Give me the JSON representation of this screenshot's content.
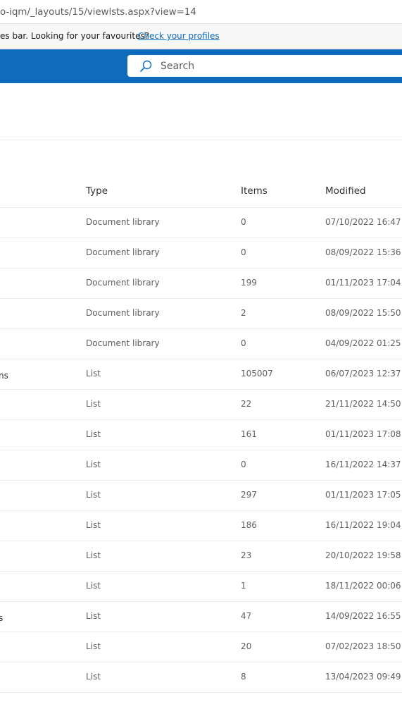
{
  "browser": {
    "address": "o-iqm/_layouts/15/viewlsts.aspx?view=14"
  },
  "info_bar": {
    "message": "es bar. Looking for your favourites?",
    "link_label": "Check your profiles"
  },
  "suite_bar": {
    "search_placeholder": "Search",
    "accent_color": "#0f6cbd"
  },
  "table": {
    "columns": [
      "Type",
      "Items",
      "Modified"
    ],
    "rows": [
      {
        "name": "",
        "type": "Document library",
        "items": "0",
        "modified": "07/10/2022 16:47"
      },
      {
        "name": "",
        "type": "Document library",
        "items": "0",
        "modified": "08/09/2022 15:36"
      },
      {
        "name": "",
        "type": "Document library",
        "items": "199",
        "modified": "01/11/2023 17:04"
      },
      {
        "name": "",
        "type": "Document library",
        "items": "2",
        "modified": "08/09/2022 15:50"
      },
      {
        "name": "",
        "type": "Document library",
        "items": "0",
        "modified": "04/09/2022 01:25"
      },
      {
        "name": "ns",
        "type": "List",
        "items": "105007",
        "modified": "06/07/2023 12:37"
      },
      {
        "name": "",
        "type": "List",
        "items": "22",
        "modified": "21/11/2022 14:50"
      },
      {
        "name": "",
        "type": "List",
        "items": "161",
        "modified": "01/11/2023 17:08"
      },
      {
        "name": "",
        "type": "List",
        "items": "0",
        "modified": "16/11/2022 14:37"
      },
      {
        "name": "",
        "type": "List",
        "items": "297",
        "modified": "01/11/2023 17:05"
      },
      {
        "name": "",
        "type": "List",
        "items": "186",
        "modified": "16/11/2022 19:04"
      },
      {
        "name": "",
        "type": "List",
        "items": "23",
        "modified": "20/10/2022 19:58"
      },
      {
        "name": "",
        "type": "List",
        "items": "1",
        "modified": "18/11/2022 00:06"
      },
      {
        "name": "s",
        "type": "List",
        "items": "47",
        "modified": "14/09/2022 16:55"
      },
      {
        "name": "",
        "type": "List",
        "items": "20",
        "modified": "07/02/2023 18:50"
      },
      {
        "name": "",
        "type": "List",
        "items": "8",
        "modified": "13/04/2023 09:49"
      }
    ]
  }
}
